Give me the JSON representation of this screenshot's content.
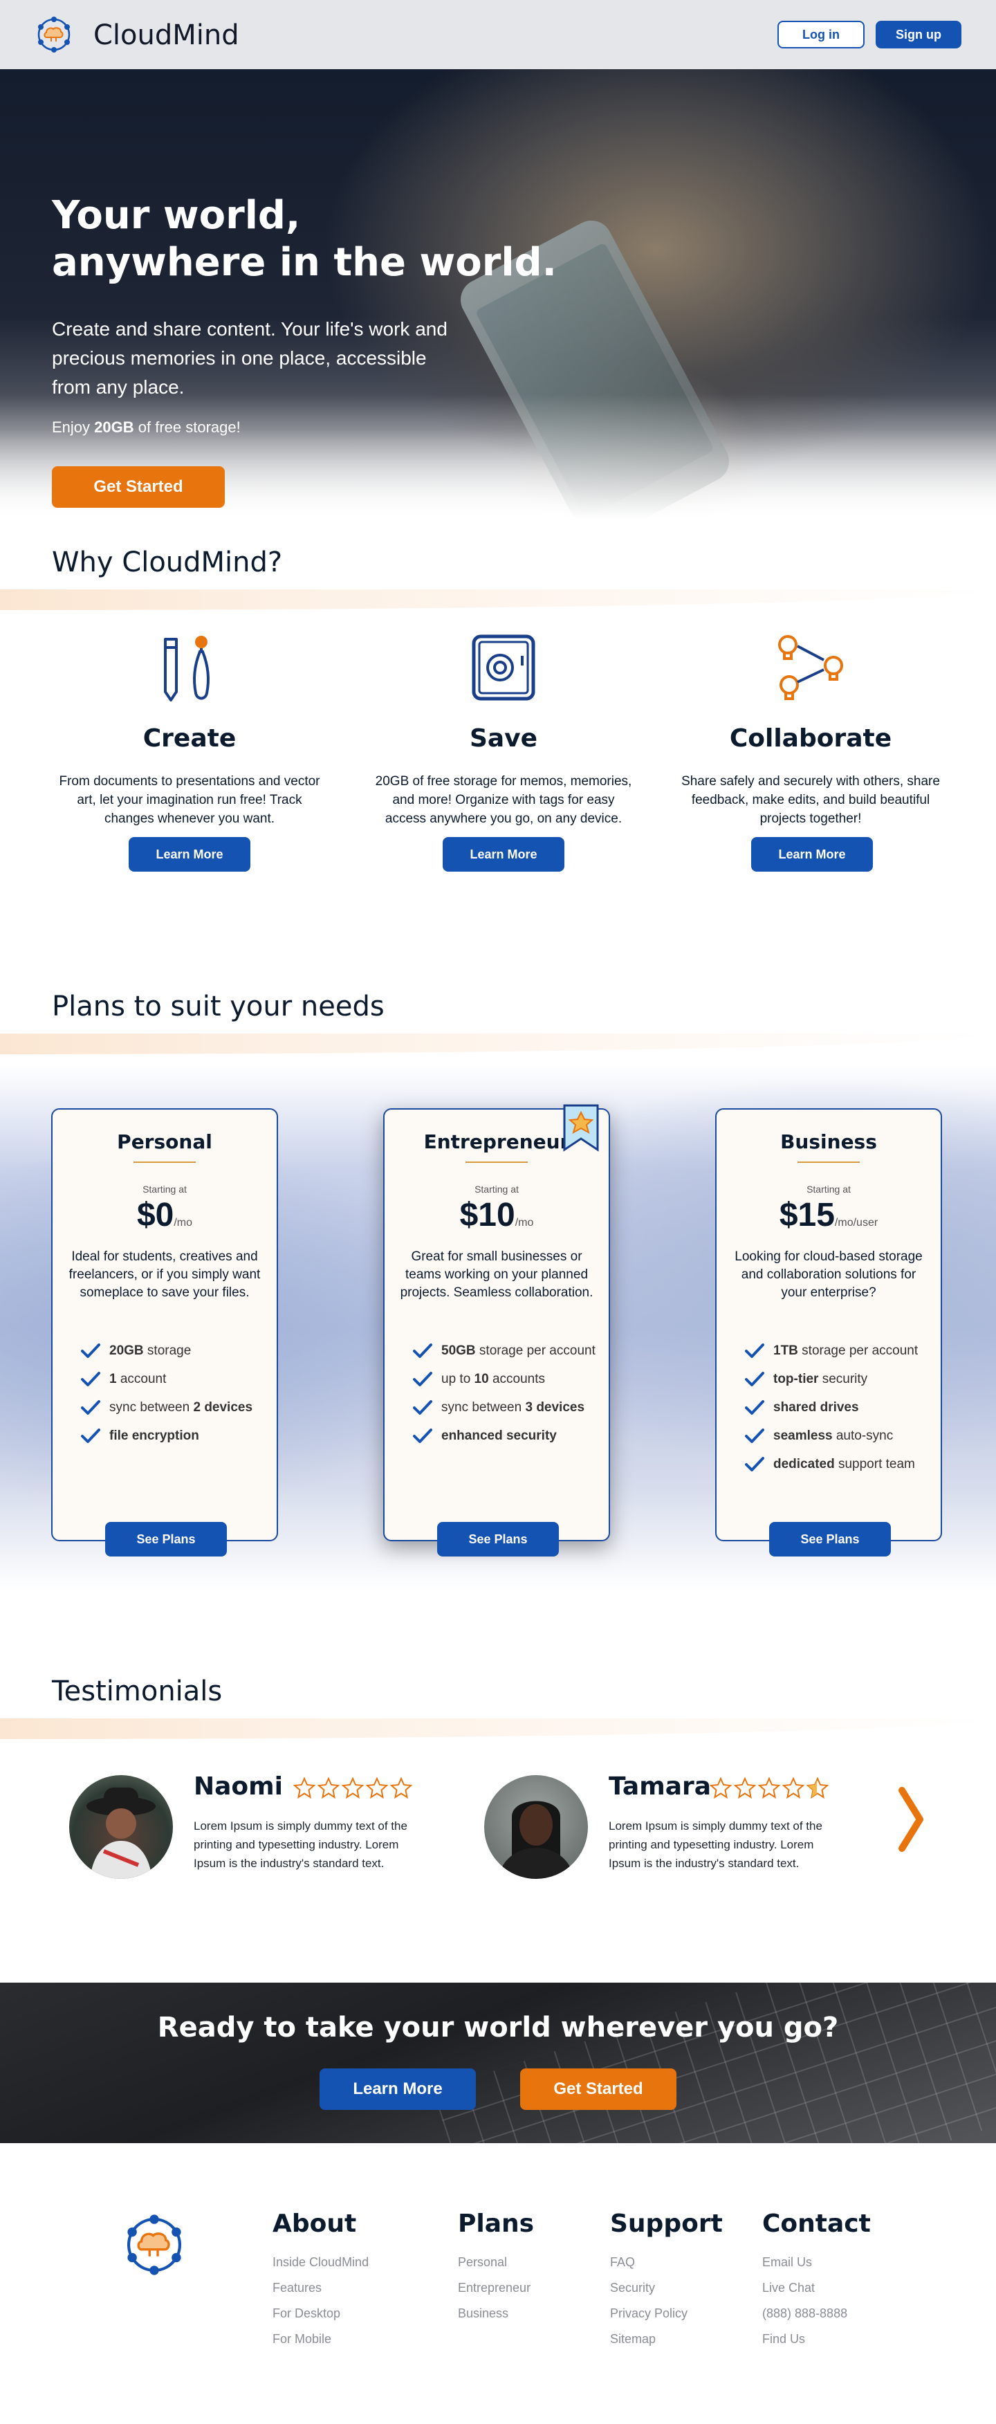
{
  "header": {
    "brand": "CloudMind",
    "login": "Log in",
    "signup": "Sign up"
  },
  "hero": {
    "title_line1": "Your world,",
    "title_line2": "anywhere in the world.",
    "subtitle": "Create and share content. Your life's work and precious memories in one place, accessible from any place.",
    "enjoy_prefix": "Enjoy ",
    "enjoy_bold": "20GB",
    "enjoy_suffix": " of free storage!",
    "cta": "Get Started"
  },
  "why": {
    "heading": "Why CloudMind?",
    "features": [
      {
        "title": "Create",
        "text": "From documents to presentations and vector art, let your imagination run free! Track changes whenever you want.",
        "button": "Learn More",
        "icon": "pencil-brush-icon"
      },
      {
        "title": "Save",
        "text": "20GB of free storage for memos, memories, and more! Organize with tags for easy access anywhere you go, on any device.",
        "button": "Learn More",
        "icon": "safe-icon"
      },
      {
        "title": "Collaborate",
        "text": "Share safely and securely with others, share feedback, make edits, and build beautiful projects together!",
        "button": "Learn More",
        "icon": "lightbulbs-icon"
      }
    ]
  },
  "plans": {
    "heading": "Plans to suit your needs",
    "starting_at": "Starting at",
    "items": [
      {
        "name": "Personal",
        "price": "$0",
        "per": "/mo",
        "desc": "Ideal for students, creatives and freelancers, or if you simply want someplace to save your files.",
        "features": [
          [
            "",
            "20GB",
            " storage"
          ],
          [
            "",
            "1",
            " account"
          ],
          [
            "sync between ",
            "2 devices",
            ""
          ],
          [
            "",
            "file encryption",
            ""
          ]
        ],
        "button": "See Plans"
      },
      {
        "name": "Entrepreneur",
        "price": "$10",
        "per": "/mo",
        "desc": "Great for small businesses or teams working on your planned projects. Seamless collaboration.",
        "features": [
          [
            "",
            "50GB",
            " storage per account"
          ],
          [
            "up to ",
            "10",
            " accounts"
          ],
          [
            "sync between ",
            "3 devices",
            ""
          ],
          [
            "",
            "enhanced security",
            ""
          ]
        ],
        "button": "See Plans"
      },
      {
        "name": "Business",
        "price": "$15",
        "per": "/mo/user",
        "desc": "Looking for cloud-based storage and collaboration solutions for your enterprise?",
        "features": [
          [
            "",
            "1TB",
            " storage per account"
          ],
          [
            "",
            "top-tier",
            " security"
          ],
          [
            "",
            "shared drives",
            ""
          ],
          [
            "",
            "seamless",
            " auto-sync"
          ],
          [
            "",
            "dedicated",
            " support team"
          ]
        ],
        "button": "See Plans"
      }
    ]
  },
  "testimonials": {
    "heading": "Testimonials",
    "items": [
      {
        "name": "Naomi",
        "rating": 5,
        "text": "Lorem Ipsum is simply dummy text of the printing and typesetting industry. Lorem Ipsum is the industry's standard text."
      },
      {
        "name": "Tamara",
        "rating": 4.5,
        "text": "Lorem Ipsum is simply dummy text of the printing and typesetting industry. Lorem Ipsum is the industry's standard text."
      }
    ]
  },
  "cta_band": {
    "heading": "Ready to take your world wherever you go?",
    "learn_more": "Learn More",
    "get_started": "Get Started"
  },
  "footer": {
    "columns": [
      {
        "title": "About",
        "links": [
          "Inside CloudMind",
          "Features",
          "For Desktop",
          "For Mobile"
        ]
      },
      {
        "title": "Plans",
        "links": [
          "Personal",
          "Entrepreneur",
          "Business"
        ]
      },
      {
        "title": "Support",
        "links": [
          "FAQ",
          "Security",
          "Privacy Policy",
          "Sitemap"
        ]
      },
      {
        "title": "Contact",
        "links": [
          "Email Us",
          "Live Chat",
          "(888) 888-8888",
          "Find Us"
        ]
      }
    ]
  },
  "colors": {
    "primary": "#1553b3",
    "accent": "#e8740e",
    "dark": "#0c1a2e"
  }
}
